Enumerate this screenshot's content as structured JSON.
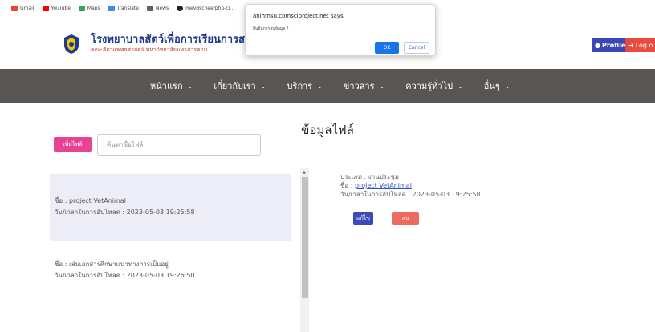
{
  "bookmarks": [
    {
      "label": "Gmail",
      "color": "#ea4335"
    },
    {
      "label": "YouTube",
      "color": "#ff0000"
    },
    {
      "label": "Maps",
      "color": "#34a853"
    },
    {
      "label": "Translate",
      "color": "#4285f4"
    },
    {
      "label": "News",
      "color": "#5f6368"
    },
    {
      "label": "mevdschee/php-cr...",
      "color": "#222222"
    }
  ],
  "header": {
    "title": "โรงพยาบาลสัตว์เพื่อการเรียนการสอน",
    "subtitle": "คณะสัตวแพทยศาสตร์ มหาวิทยาลัยมหาสารคาม",
    "profile_label": "Profile",
    "logout_label": "Log o"
  },
  "nav": [
    "หน้าแรก",
    "เกี่ยวกับเรา",
    "บริการ",
    "ข่าวสาร",
    "ความรู้ทั่วไป",
    "อื่นๆ"
  ],
  "page": {
    "title": "ข้อมูลไฟล์",
    "add_button": "เพิ่มไฟล์",
    "search_placeholder": "ค้นหาชื่อไฟล์"
  },
  "files": [
    {
      "name": "ชื่อ : project VetAnimal",
      "uploaded": "วัน/เวลาในการอัปโหลด : 2023-05-03 19:25:58"
    },
    {
      "name": "ชื่อ : เล่มเอกสารศึกษาแนวทางการเป็นอยู่",
      "uploaded": "วัน/เวลาในการอัปโหลด : 2023-05-03 19:26:50"
    }
  ],
  "detail": {
    "type": "ประเภท : งานประชุม",
    "name_label": "ชื่อ : ",
    "name_link": "project VetAnimal",
    "uploaded": "วัน/เวลาในการอัปโหลด : 2023-05-03 19:25:58",
    "edit_label": "แก้ไข",
    "delete_label": "ลบ"
  },
  "dialog": {
    "title": "anihmsu.comsciproject.net says",
    "message": "ยืนยันการลบข้อมูล ?",
    "ok_label": "OK",
    "cancel_label": "Cancel"
  },
  "colors": {
    "nav_bg": "#595552",
    "accent_pink": "#e84393",
    "selected_row": "#ededf7",
    "edit_blue": "#3b4ab8",
    "delete_red": "#ee6a5e"
  }
}
